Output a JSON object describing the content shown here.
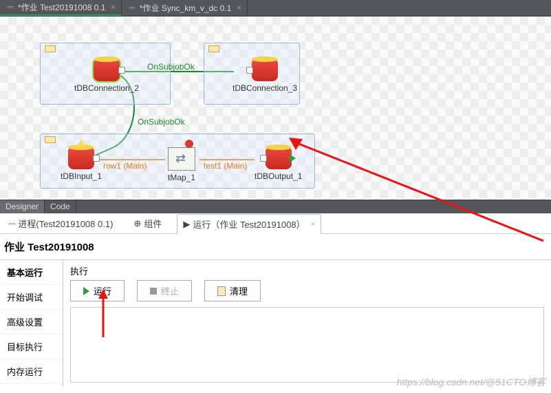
{
  "topTabs": [
    {
      "label": "*作业 Test20191008 0.1",
      "active": true
    },
    {
      "label": "*作业 Sync_km_v_dc 0.1",
      "active": false
    }
  ],
  "canvas": {
    "components": {
      "conn2": "tDBConnection_2",
      "conn3": "tDBConnection_3",
      "input1": "tDBInput_1",
      "tmap1": "tMap_1",
      "output1": "tDBOutput_1"
    },
    "links": {
      "onSubjobOk1": "OnSubjobOk",
      "onSubjobOk2": "OnSubjobOk",
      "row1": "row1 (Main)",
      "test1": "test1 (Main)"
    }
  },
  "dividerTabs": {
    "designer": "Designer",
    "code": "Code"
  },
  "bottomTabs": {
    "process": "进程(Test20191008 0.1)",
    "component": "组件",
    "run": "运行（作业 Test20191008）"
  },
  "jobTitle": "作业 Test20191008",
  "sidebar": {
    "basicRun": "基本运行",
    "startDebug": "开始调试",
    "advSettings": "高级设置",
    "targetExec": "目标执行",
    "memRun": "内存运行"
  },
  "exec": {
    "label": "执行",
    "run": "运行",
    "stop": "终止",
    "clean": "清理"
  },
  "watermark": "https://blog.csdn.net/@51CTO博客"
}
